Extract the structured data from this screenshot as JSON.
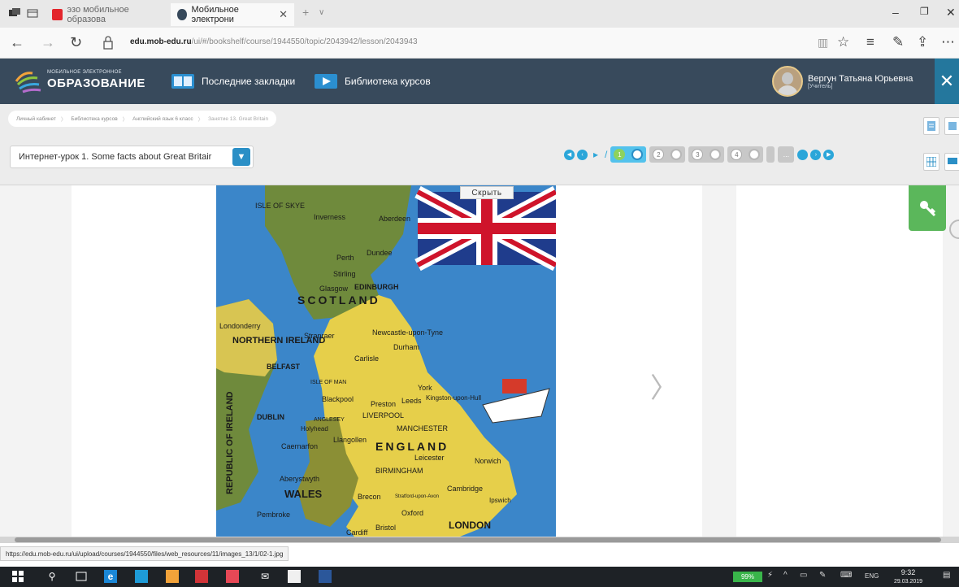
{
  "browser": {
    "tabs": [
      {
        "label": "эзо мобильное образова"
      },
      {
        "label": "Мобильное электрони"
      }
    ],
    "url_host": "edu.mob-edu.ru",
    "url_path": "/ui/#/bookshelf/course/1944550/topic/2043942/lesson/2043943"
  },
  "site": {
    "logo_small": "МОБИЛЬНОЕ ЭЛЕКТРОННОЕ",
    "logo_big": "ОБРАЗОВАНИЕ",
    "nav_bookmarks": "Последние закладки",
    "nav_library": "Библиотека курсов",
    "user_name": "Вергун Татьяна Юрьевна",
    "user_role": "[Учитель]"
  },
  "breadcrumbs": [
    {
      "label": "Личный кабинет"
    },
    {
      "label": "Библиотека курсов"
    },
    {
      "label": "Английский язык 6 класс"
    },
    {
      "label": "Занятие 13. Great Britain"
    }
  ],
  "lesson": {
    "selected": "Интернет-урок 1. Some facts about Great Britair"
  },
  "pager": {
    "steps": [
      "1",
      "2",
      "3",
      "4"
    ],
    "more": "..."
  },
  "content": {
    "hide_button": "Скрыть",
    "map_labels": {
      "isle_of_skye": "ISLE OF SKYE",
      "inverness": "Inverness",
      "aberdeen": "Aberdeen",
      "perth": "Perth",
      "dundee": "Dundee",
      "stirling": "Stirling",
      "glasgow": "Glasgow",
      "edinburgh": "EDINBURGH",
      "scotland": "SCOTLAND",
      "londonderry": "Londonderry",
      "northern_ireland": "NORTHERN IRELAND",
      "stranraer": "Stranraer",
      "newcastle": "Newcastle-upon-Tyne",
      "durham": "Durham",
      "carlisle": "Carlisle",
      "belfast": "BELFAST",
      "isle_of_man": "ISLE OF MAN",
      "york": "York",
      "hull": "Kingston-upon-Hull",
      "blackpool": "Blackpool",
      "preston": "Preston",
      "leeds": "Leeds",
      "republic_of_ireland": "REPUBLIC OF IRELAND",
      "dublin": "DUBLIN",
      "anglesey": "ANGLESEY",
      "liverpool": "LIVERPOOL",
      "holyhead": "Holyhead",
      "manchester": "MANCHESTER",
      "caernarfon": "Caernarfon",
      "llangollen": "Llangollen",
      "england": "ENGLAND",
      "leicester": "Leicester",
      "norwich": "Norwich",
      "birmingham": "BIRMINGHAM",
      "aberystwyth": "Aberystwyth",
      "wales": "WALES",
      "cambridge": "Cambridge",
      "ipswich": "Ipswich",
      "brecon": "Brecon",
      "stratford": "Stratford-upon-Avon",
      "pembroke": "Pembroke",
      "oxford": "Oxford",
      "cardiff": "Cardiff",
      "bristol": "Bristol",
      "london": "LONDON"
    }
  },
  "status_url": "https://edu.mob-edu.ru/ui/upload/courses/1944550/files/web_resources/11/images_13/1/02-1.jpg",
  "taskbar": {
    "battery": "99%",
    "lang": "ENG",
    "time": "9:32",
    "date": "29.03.2019"
  },
  "colors": {
    "header_bg": "#384a5c",
    "accent_blue": "#2a8fc6",
    "key_green": "#5bb75b",
    "sea_blue": "#3b86c9",
    "scotland_green": "#6f8a3c",
    "england_yellow": "#e6cf4a"
  }
}
